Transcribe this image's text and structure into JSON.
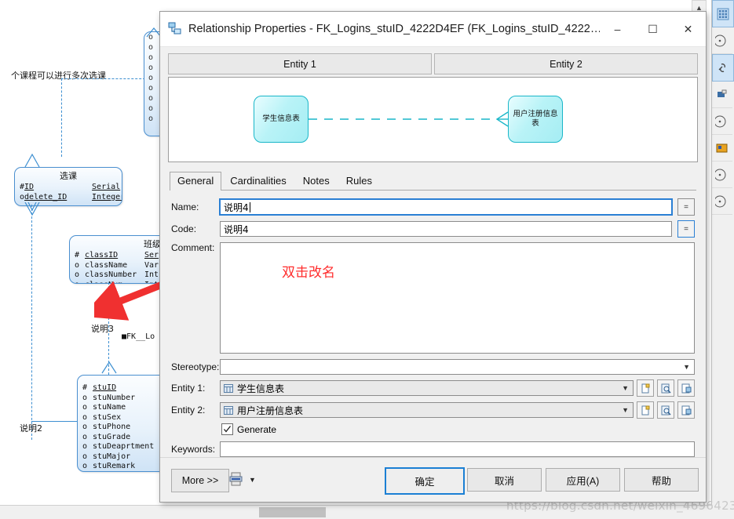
{
  "dialog": {
    "title": "Relationship Properties - FK_Logins_stuID_4222D4EF (FK_Logins_stuID_4222…",
    "icon": "relationship-icon",
    "window_controls": {
      "minimize": "–",
      "maximize": "☐",
      "close": "✕"
    },
    "preview": {
      "head1": "Entity 1",
      "head2": "Entity 2",
      "entity1": "学生信息表",
      "entity2": "用户注册信息表"
    },
    "tabs": [
      {
        "label": "General",
        "active": true
      },
      {
        "label": "Cardinalities",
        "active": false
      },
      {
        "label": "Notes",
        "active": false
      },
      {
        "label": "Rules",
        "active": false
      }
    ],
    "fields": {
      "name_label": "Name:",
      "name_value": "说明4",
      "code_label": "Code:",
      "code_value": "说明4",
      "comment_label": "Comment:",
      "comment_annotation": "双击改名",
      "stereotype_label": "Stereotype:",
      "stereotype_value": "",
      "entity1_label": "Entity 1:",
      "entity1_value": "学生信息表",
      "entity2_label": "Entity 2:",
      "entity2_value": "用户注册信息表",
      "generate_label": "Generate",
      "generate_checked": true,
      "keywords_label": "Keywords:",
      "keywords_value": "",
      "equals_button": "="
    },
    "footer": {
      "more": "More >>",
      "print_icon": "print-report-icon",
      "ok": "确定",
      "cancel": "取消",
      "apply": "应用(A)",
      "help": "帮助"
    }
  },
  "background": {
    "annotations": {
      "note_top": "个课程可以进行多次选课",
      "label_shuoming3": "说明3",
      "label_fk": "FK__Lo",
      "label_shuoming2": "说明2"
    },
    "entities": [
      {
        "title": "选课",
        "rows": [
          {
            "mark": "#",
            "name": "ID",
            "type": "Serial"
          },
          {
            "mark": "o",
            "name": "delete_ID",
            "type": "Integer"
          }
        ]
      },
      {
        "title": "班级",
        "rows": [
          {
            "mark": "#",
            "name": "classID",
            "type": "Ser"
          },
          {
            "mark": "o",
            "name": "className",
            "type": "Var"
          },
          {
            "mark": "o",
            "name": "classNumber",
            "type": "Int"
          },
          {
            "mark": "o",
            "name": "classNum",
            "type": "Int"
          }
        ]
      },
      {
        "title": "",
        "rows": [
          {
            "mark": "#",
            "name": "stuID",
            "type": ""
          },
          {
            "mark": "o",
            "name": "stuNumber",
            "type": ""
          },
          {
            "mark": "o",
            "name": "stuName",
            "type": ""
          },
          {
            "mark": "o",
            "name": "stuSex",
            "type": ""
          },
          {
            "mark": "o",
            "name": "stuPhone",
            "type": ""
          },
          {
            "mark": "o",
            "name": "stuGrade",
            "type": ""
          },
          {
            "mark": "o",
            "name": "stuDeaprtment",
            "type": ""
          },
          {
            "mark": "o",
            "name": "stuMajor",
            "type": ""
          },
          {
            "mark": "o",
            "name": "stuRemark",
            "type": ""
          }
        ]
      }
    ],
    "watermark": "https://blog.csdn.net/weixin_4696423"
  }
}
